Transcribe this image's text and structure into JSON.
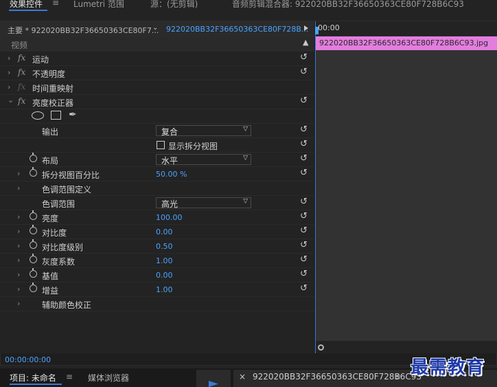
{
  "tabs": [
    {
      "label": "效果控件"
    },
    {
      "label": "Lumetri 范围"
    },
    {
      "label": "源：(无剪辑)"
    },
    {
      "label": "音频剪辑混合器: 922020BB32F36650363CE80F728B6C93"
    }
  ],
  "menu_glyph": "≡",
  "source_bar": {
    "master_label": "主要 * 922020BB32F36650363CE80F7...",
    "chevron": "⌄",
    "clip_label": "922020BB32F36650363CE80F728B..."
  },
  "video_header": "视频",
  "effects": [
    {
      "label": "运动"
    },
    {
      "label": "不透明度"
    },
    {
      "label": "时间重映射"
    },
    {
      "label": "亮度校正器"
    }
  ],
  "fx_label": "fx",
  "params": {
    "output": {
      "label": "输出",
      "value": "复合"
    },
    "split_view": {
      "label": "显示拆分视图"
    },
    "layout": {
      "label": "布局",
      "value": "水平"
    },
    "split_pct": {
      "label": "拆分视图百分比",
      "value": "50.00 %"
    },
    "tonal_def": {
      "label": "色调范围定义"
    },
    "tonal_range": {
      "label": "色调范围",
      "value": "高光"
    },
    "brightness": {
      "label": "亮度",
      "value": "100.00"
    },
    "contrast": {
      "label": "对比度",
      "value": "0.00"
    },
    "contrast_level": {
      "label": "对比度级别",
      "value": "0.50"
    },
    "gamma": {
      "label": "灰度系数",
      "value": "1.00"
    },
    "pedestal": {
      "label": "基值",
      "value": "0.00"
    },
    "gain": {
      "label": "增益",
      "value": "1.00"
    },
    "secondary": {
      "label": "辅助颜色校正"
    }
  },
  "timeline": {
    "timecode": "00:00",
    "clip_name": "922020BB32F36650363CE80F728B6C93.jpg"
  },
  "panel_timecode": "00:00:00:00",
  "bottom": {
    "project_tab": "项目: 未命名",
    "media_tab": "媒体浏览器",
    "seq_close": "×",
    "seq_tab": "922020BB32F36650363CE80F728B6C93"
  },
  "watermark": "最需教育",
  "colors": {
    "accent": "#3a7bd5",
    "value_blue": "#4aa3ff",
    "clip_pink": "#e37dde"
  }
}
